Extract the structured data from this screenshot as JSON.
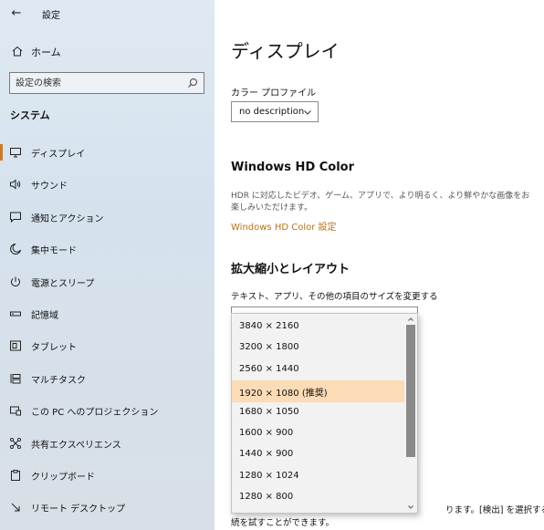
{
  "window": {
    "title": "設定",
    "back_label": "←"
  },
  "sidebar": {
    "home_label": "ホーム",
    "search_placeholder": "設定の検索",
    "section_title": "システム",
    "items": [
      {
        "label": "ディスプレイ",
        "icon": "monitor-icon",
        "active": true
      },
      {
        "label": "サウンド",
        "icon": "speaker-icon",
        "active": false
      },
      {
        "label": "通知とアクション",
        "icon": "notification-icon",
        "active": false
      },
      {
        "label": "集中モード",
        "icon": "moon-icon",
        "active": false
      },
      {
        "label": "電源とスリープ",
        "icon": "power-icon",
        "active": false
      },
      {
        "label": "記憶域",
        "icon": "storage-icon",
        "active": false
      },
      {
        "label": "タブレット",
        "icon": "tablet-icon",
        "active": false
      },
      {
        "label": "マルチタスク",
        "icon": "multitask-icon",
        "active": false
      },
      {
        "label": "この PC へのプロジェクション",
        "icon": "projection-icon",
        "active": false
      },
      {
        "label": "共有エクスペリエンス",
        "icon": "share-icon",
        "active": false
      },
      {
        "label": "クリップボード",
        "icon": "clipboard-icon",
        "active": false
      },
      {
        "label": "リモート デスクトップ",
        "icon": "remote-desktop-icon",
        "active": false
      }
    ]
  },
  "main": {
    "page_title": "ディスプレイ",
    "color_profile_label": "カラー プロファイル",
    "color_profile_value": "no description",
    "hdr_heading": "Windows HD Color",
    "hdr_description": "HDR に対応したビデオ、ゲーム、アプリで、より明るく、より鮮やかな画像をお楽しみいただけます。",
    "hdr_link": "Windows HD Color 設定",
    "scale_heading": "拡大縮小とレイアウト",
    "scale_label": "テキスト、アプリ、その他の項目のサイズを変更する",
    "behind_text_line1": "ります。[検出] を選択すると接",
    "behind_text_line2": "続を試すことができます。"
  },
  "resolution_dropdown": {
    "options": [
      "3840 × 2160",
      "3200 × 1800",
      "2560 × 1440",
      "1920 × 1080 (推奨)",
      "1680 × 1050",
      "1600 × 900",
      "1440 × 900",
      "1280 × 1024",
      "1280 × 800"
    ],
    "selected": "1920 × 1080 (推奨)"
  },
  "colors": {
    "accent": "#b8721c",
    "selected_bg": "#fbdcb7",
    "active_marker": "#c97b2a"
  }
}
